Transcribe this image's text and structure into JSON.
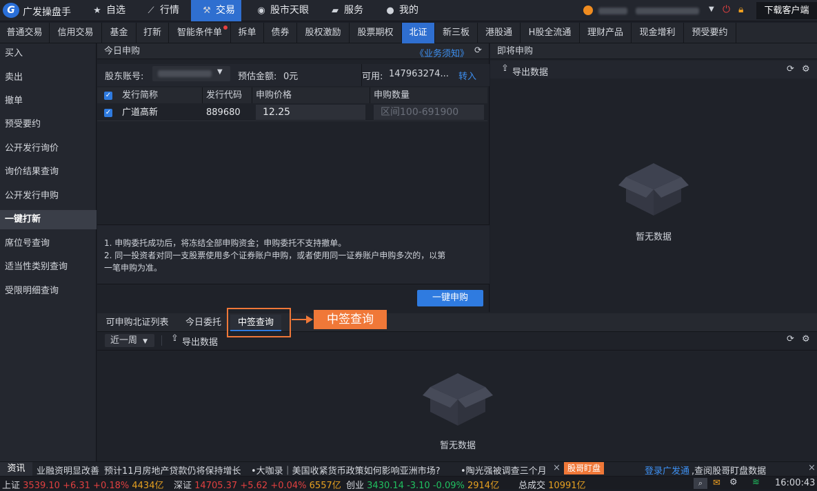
{
  "topbar": {
    "logo_text": "G",
    "app_name": "广发操盘手",
    "nav": [
      {
        "label": "自选",
        "icon": "star-icon"
      },
      {
        "label": "行情",
        "icon": "chart-icon"
      },
      {
        "label": "交易",
        "icon": "hammer-icon",
        "active": true
      },
      {
        "label": "股市天眼",
        "icon": "eye-icon"
      },
      {
        "label": "服务",
        "icon": "briefcase-icon"
      },
      {
        "label": "我的",
        "icon": "user-icon"
      }
    ],
    "download_label": "下载客户端"
  },
  "subnav": [
    "普通交易",
    "信用交易",
    "基金",
    "打新",
    "智能条件单",
    "拆单",
    "债券",
    "股权激励",
    "股票期权",
    "北证",
    "新三板",
    "港股通",
    "H股全流通",
    "理财产品",
    "现金增利",
    "预受要约"
  ],
  "subnav_active": "北证",
  "sidebar": [
    "买入",
    "卖出",
    "撤单",
    "预受要约",
    "公开发行询价",
    "询价结果查询",
    "公开发行申购",
    "一键打新",
    "席位号查询",
    "适当性类别查询",
    "受限明细查询"
  ],
  "sidebar_active": "一键打新",
  "today": {
    "title": "今日申购",
    "notice_link": "《业务须知》",
    "account_label": "股东账号:",
    "estimate_label": "预估金额:",
    "estimate_value": "0元",
    "available_label": "可用:",
    "available_value": "147963274...",
    "transfer_in": "转入",
    "columns": [
      "发行简称",
      "发行代码",
      "申购价格",
      "申购数量"
    ],
    "rows": [
      {
        "name": "广道高新",
        "code": "889680",
        "price": "12.25",
        "qty_placeholder": "区间100-691900"
      }
    ],
    "notes": [
      "1. 申购委托成功后，将冻结全部申购资金；申购委托不支持撤单。",
      "2. 同一投资者对同一支股票使用多个证券账户申购，或者使用同一证券账户申购多次的，以第",
      "一笔申购为准。"
    ],
    "submit_label": "一键申购"
  },
  "upcoming": {
    "title": "即将申购",
    "export_label": "导出数据",
    "empty_text": "暂无数据"
  },
  "bottom": {
    "tabs": [
      "可申购北证列表",
      "今日委托",
      "中签查询"
    ],
    "active_tab": "中签查询",
    "callout": "中签查询",
    "period": "近一周",
    "export_label": "导出数据",
    "empty_text": "暂无数据"
  },
  "news": {
    "label": "资讯",
    "items": [
      "业融资明显改善",
      "预计11月房地产贷款仍将保持增长",
      "•大咖录｜美国收紧货币政策如何影响亚洲市场?",
      "•陶光强被调查三个月"
    ],
    "tag": "股哥盯盘",
    "login_link": "登录广发通",
    "login_text": ",查阅股哥盯盘数据"
  },
  "status": {
    "sh": {
      "label": "上证",
      "value": "3539.10",
      "change": "+6.31",
      "pct": "+0.18%",
      "amount": "4434亿"
    },
    "sz": {
      "label": "深证",
      "value": "14705.37",
      "change": "+5.62",
      "pct": "+0.04%",
      "amount": "6557亿"
    },
    "cy": {
      "label": "创业",
      "value": "3430.14",
      "change": "-3.10",
      "pct": "-0.09%",
      "amount": "2914亿"
    },
    "total_label": "总成交",
    "total_value": "10991亿",
    "time": "16:00:43"
  },
  "colors": {
    "accent": "#2f7be0",
    "callout": "#f07838",
    "up": "#e04040",
    "down": "#20c060",
    "amount": "#e6a020"
  }
}
